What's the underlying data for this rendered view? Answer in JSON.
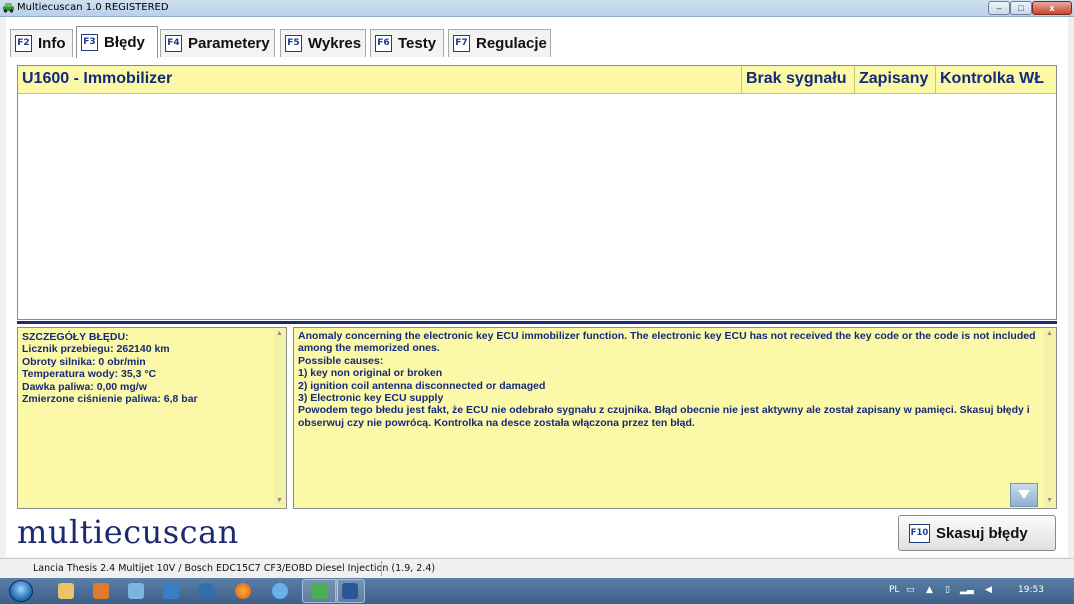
{
  "window": {
    "title": "Multiecuscan 1.0 REGISTERED",
    "controls": {
      "minimize": "–",
      "maximize": "□",
      "close": "x"
    }
  },
  "tabs": [
    {
      "key": "F2",
      "label": "Info",
      "active": false
    },
    {
      "key": "F3",
      "label": "Błędy",
      "active": true
    },
    {
      "key": "F4",
      "label": "Parametery",
      "active": false
    },
    {
      "key": "F5",
      "label": "Wykres",
      "active": false
    },
    {
      "key": "F6",
      "label": "Testy",
      "active": false
    },
    {
      "key": "F7",
      "label": "Regulacje",
      "active": false
    }
  ],
  "errors": {
    "rows": [
      {
        "code": "U1600 - Immobilizer",
        "signal": "Brak sygnału",
        "stored": "Zapisany",
        "lamp": "Kontrolka WŁ"
      }
    ]
  },
  "details": {
    "left_lines": [
      "SZCZEGÓŁY BŁĘDU:",
      "Licznik przebiegu: 262140 km",
      "Obroty silnika: 0 obr/min",
      "Temperatura wody: 35,3 °C",
      "Dawka paliwa: 0,00 mg/w",
      "Zmierzone ciśnienie paliwa: 6,8 bar"
    ],
    "right_lines": [
      "Anomaly concerning the electronic key ECU immobilizer function. The electronic key ECU has not received the key code or the code is not included among the memorized ones.",
      "Possible causes:",
      "1) key non original or broken",
      "2) ignition coil antenna disconnected or damaged",
      "3) Electronic key ECU supply",
      "Powodem tego błedu jest fakt, że ECU nie odebrało sygnału z czujnika. Błąd obecnie nie jest aktywny ale został zapisany w pamięci. Skasuj błędy i obserwuj czy nie powrócą. Kontrolka na desce została włączona przez ten błąd."
    ]
  },
  "logo": {
    "text": "multiecuscan"
  },
  "clear_button": {
    "key": "F10",
    "label": "Skasuj błędy"
  },
  "status": {
    "vehicle": "Lancia Thesis 2.4 Multijet 10V / Bosch EDC15C7 CF3/EOBD Diesel Injection (1.9, 2.4)"
  },
  "taskbar": {
    "language": "PL",
    "time": "19:53",
    "icons": [
      "explorer-icon",
      "media-icon",
      "paint-icon",
      "ie-icon",
      "cloud-icon",
      "firefox-icon",
      "ie-alt-icon",
      "multiecuscan-icon",
      "word-icon"
    ]
  },
  "colors": {
    "panel_yellow": "#fbf8a8",
    "text_navy": "#152a7a",
    "divider": "#1d2b73",
    "logo": "#1d2b6e"
  }
}
